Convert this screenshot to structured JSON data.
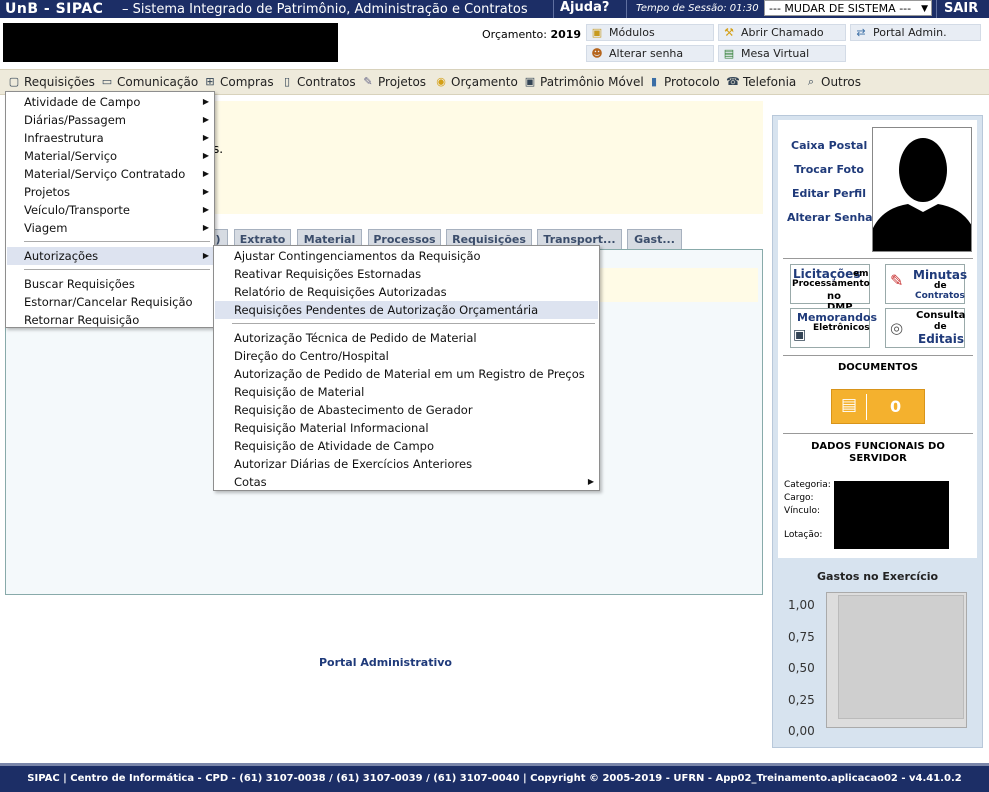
{
  "topbar": {
    "brand": "UnB - SIPAC",
    "system_name": "– Sistema Integrado de Patrimônio, Administração e Contratos",
    "help": "Ajuda?",
    "session": "Tempo de Sessão: 01:30",
    "change_system": "--- MUDAR DE SISTEMA ---",
    "logout": "SAIR"
  },
  "header": {
    "budget_label": "Orçamento:",
    "budget_year": "2019",
    "buttons": [
      "Módulos",
      "Abrir Chamado",
      "Portal Admin.",
      "Alterar senha",
      "Mesa Virtual"
    ]
  },
  "menubar": {
    "items": [
      "Requisições",
      "Comunicação",
      "Compras",
      "Contratos",
      "Projetos",
      "Orçamento",
      "Patrimônio Móvel",
      "Protocolo",
      "Telefonia",
      "Outros"
    ]
  },
  "main": {
    "partial_text": "s.",
    "tabs": [
      ")",
      "Extrato",
      "Material",
      "Processos",
      "Requisições",
      "Transport...",
      "Gast..."
    ],
    "portal_link": "Portal Administrativo"
  },
  "dropdown": {
    "items": [
      "Atividade de Campo",
      "Diárias/Passagem",
      "Infraestrutura",
      "Material/Serviço",
      "Material/Serviço Contratado",
      "Projetos",
      "Veículo/Transporte",
      "Viagem",
      "Autorizações",
      "Buscar Requisições",
      "Estornar/Cancelar Requisição",
      "Retornar Requisição"
    ]
  },
  "submenu": {
    "items": [
      "Ajustar Contingenciamentos da Requisição",
      "Reativar Requisições Estornadas",
      "Relatório de Requisições Autorizadas",
      "Requisições Pendentes de Autorização Orçamentária",
      "Autorização Técnica de Pedido de Material",
      "Direção do Centro/Hospital",
      "Autorização de Pedido de Material em um Registro de Preços",
      "Requisição de Material",
      "Requisição de Abastecimento de Gerador",
      "Requisição Material Informacional",
      "Requisição de Atividade de Campo",
      "Autorizar Diárias de Exercícios Anteriores",
      "Cotas"
    ]
  },
  "sidebar": {
    "links": [
      "Caixa Postal",
      "Trocar Foto",
      "Editar Perfil",
      "Alterar Senha"
    ],
    "quick": {
      "lic_title": "Licitações",
      "lic_em": "em",
      "lic_line2": "Processamento",
      "lic_line3": "no DMP",
      "min_title": "Minutas",
      "min_de": "de",
      "min_contratos": "Contratos",
      "mem_title": "Memorandos",
      "mem_sub": "Eletrônicos",
      "cons_title": "Consulta",
      "cons_de": "de",
      "cons_editais": "Editais"
    },
    "documents_title": "DOCUMENTOS",
    "documents_count": "0",
    "func_title": "DADOS FUNCIONAIS DO SERVIDOR",
    "func_labels": [
      "Categoria:",
      "Cargo:",
      "Vínculo:",
      "Lotação:"
    ],
    "gastos_title": "Gastos no Exercício",
    "y_ticks": [
      "1,00",
      "0,75",
      "0,50",
      "0,25",
      "0,00"
    ]
  },
  "footer": {
    "text": "SIPAC | Centro de Informática - CPD - (61) 3107-0038 / (61) 3107-0039 / (61) 3107-0040 | Copyright © 2005-2019 - UFRN - App02_Treinamento.aplicacao02 - v4.41.0.2"
  }
}
